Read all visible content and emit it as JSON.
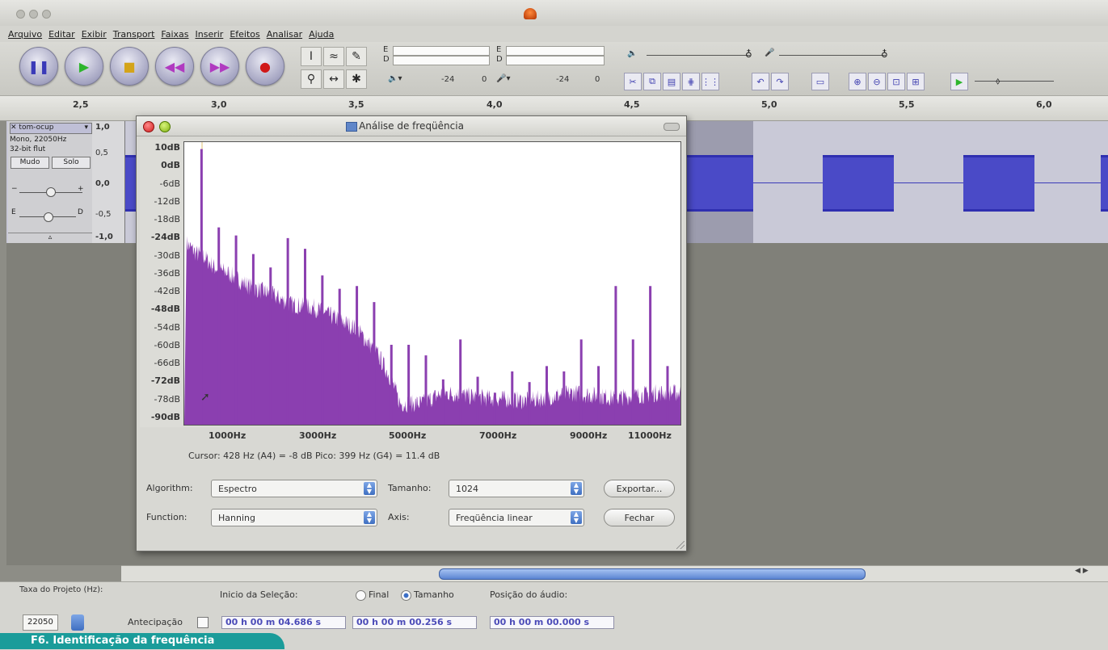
{
  "menubar": {
    "items": [
      "Arquivo",
      "Editar",
      "Exibir",
      "Transport",
      "Faixas",
      "Inserir",
      "Efeitos",
      "Analisar",
      "Ajuda"
    ]
  },
  "meters": {
    "play_label": "E",
    "play_label2": "D",
    "rec_label": "E",
    "rec_label2": "D",
    "ticks": [
      "-24",
      "0",
      "-24",
      "0"
    ]
  },
  "ruler": {
    "labels": [
      "2,5",
      "3,0",
      "3,5",
      "4,0",
      "4,5",
      "5,0",
      "5,5",
      "6,0"
    ]
  },
  "track": {
    "name": "tom-ocup",
    "info1": "Mono, 22050Hz",
    "info2": "32-bit flut",
    "mute": "Mudo",
    "solo": "Solo",
    "pan_left": "E",
    "pan_right": "D",
    "scale": [
      "1,0",
      "0,5",
      "0,0",
      "-0,5",
      "-1,0"
    ]
  },
  "dialog": {
    "title": "Análise de freqüência",
    "y_labels": [
      "10dB",
      "0dB",
      "-6dB",
      "-12dB",
      "-18dB",
      "-24dB",
      "-30dB",
      "-36dB",
      "-42dB",
      "-48dB",
      "-54dB",
      "-60dB",
      "-66dB",
      "-72dB",
      "-78dB",
      "-90dB"
    ],
    "x_labels": [
      "1000Hz",
      "3000Hz",
      "5000Hz",
      "7000Hz",
      "9000Hz",
      "11000Hz"
    ],
    "cursor_info": "Cursor: 428 Hz (A4) = -8 dB   Pico: 399 Hz (G4) = 11.4 dB",
    "algorithm_label": "Algorithm:",
    "algorithm_value": "Espectro",
    "size_label": "Tamanho:",
    "size_value": "1024",
    "export_button": "Exportar...",
    "function_label": "Function:",
    "function_value": "Hanning",
    "axis_label": "Axis:",
    "axis_value": "Freqüência linear",
    "close_button": "Fechar"
  },
  "spectrum": {
    "fill_color": "#8b3fb0",
    "profile_hz": [
      50,
      300,
      400,
      700,
      1000,
      1500,
      2000,
      2500,
      3000,
      3500,
      4000,
      4500,
      4800,
      5000,
      5500,
      6000,
      7000,
      8000,
      9000,
      10000,
      11000,
      11500
    ],
    "profile_db": [
      -24,
      -28,
      -28,
      -33,
      -35,
      -40,
      -43,
      -47,
      -48,
      -52,
      -56,
      -66,
      -75,
      -84,
      -84,
      -80,
      -82,
      -83,
      -80,
      -82,
      -80,
      -80
    ],
    "peaks_hz": [
      400,
      800,
      1200,
      1600,
      2000,
      2400,
      2800,
      3200,
      3600,
      4000,
      4400,
      4800,
      5200,
      5600,
      6000,
      6400,
      6800,
      7200,
      7600,
      8000,
      8400,
      8800,
      9200,
      9600,
      10000,
      10400,
      10800,
      11200
    ],
    "peaks_db": [
      11.4,
      -18,
      -21,
      -28,
      -33,
      -22,
      -26,
      -36,
      -41,
      -40,
      -46,
      -62,
      -62,
      -66,
      -75,
      -60,
      -74,
      -80,
      -72,
      -76,
      -70,
      -72,
      -60,
      -70,
      -40,
      -60,
      -40,
      -70
    ]
  },
  "bottombar": {
    "project_rate_label": "Taxa do Projeto (Hz):",
    "project_rate_value": "22050",
    "selection_start_label": "Inicio da Seleção:",
    "final_label": "Final",
    "length_label": "Tamanho",
    "audio_position_label": "Posição do áudio:",
    "snap_label": "Antecipação",
    "selection_start": "00 h 00 m 04.686 s",
    "selection_length": "00 h 00 m 00.256 s",
    "audio_position": "00 h 00 m 00.000 s"
  },
  "caption": "F6. Identificação da frequência"
}
